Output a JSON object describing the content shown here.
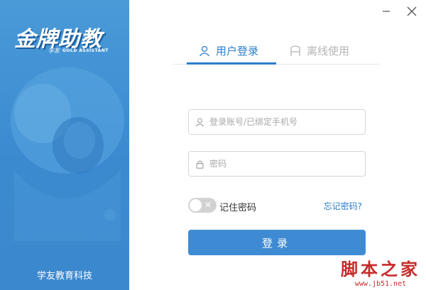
{
  "brand": {
    "logo_text": "金牌助教",
    "logo_small": "学友",
    "logo_subtitle": "GOLD ASSISTANT",
    "company": "学友教育科技",
    "primary_color": "#2b7fcb",
    "panel_color": "#3b8ad0"
  },
  "window": {
    "minimize_icon": "minimize-icon",
    "close_icon": "close-icon"
  },
  "tabs": [
    {
      "label": "用户登录",
      "icon": "user-icon",
      "active": true
    },
    {
      "label": "离线使用",
      "icon": "offline-icon",
      "active": false
    }
  ],
  "form": {
    "account_placeholder": "登录账号/已绑定手机号",
    "account_value": "",
    "password_placeholder": "密码",
    "password_value": "",
    "remember_label": "记住密码",
    "remember_on": false,
    "forgot_label": "忘记密码?",
    "login_label": "登录"
  },
  "watermark": {
    "main": "脚本之家",
    "url": "www.jb51.net"
  }
}
